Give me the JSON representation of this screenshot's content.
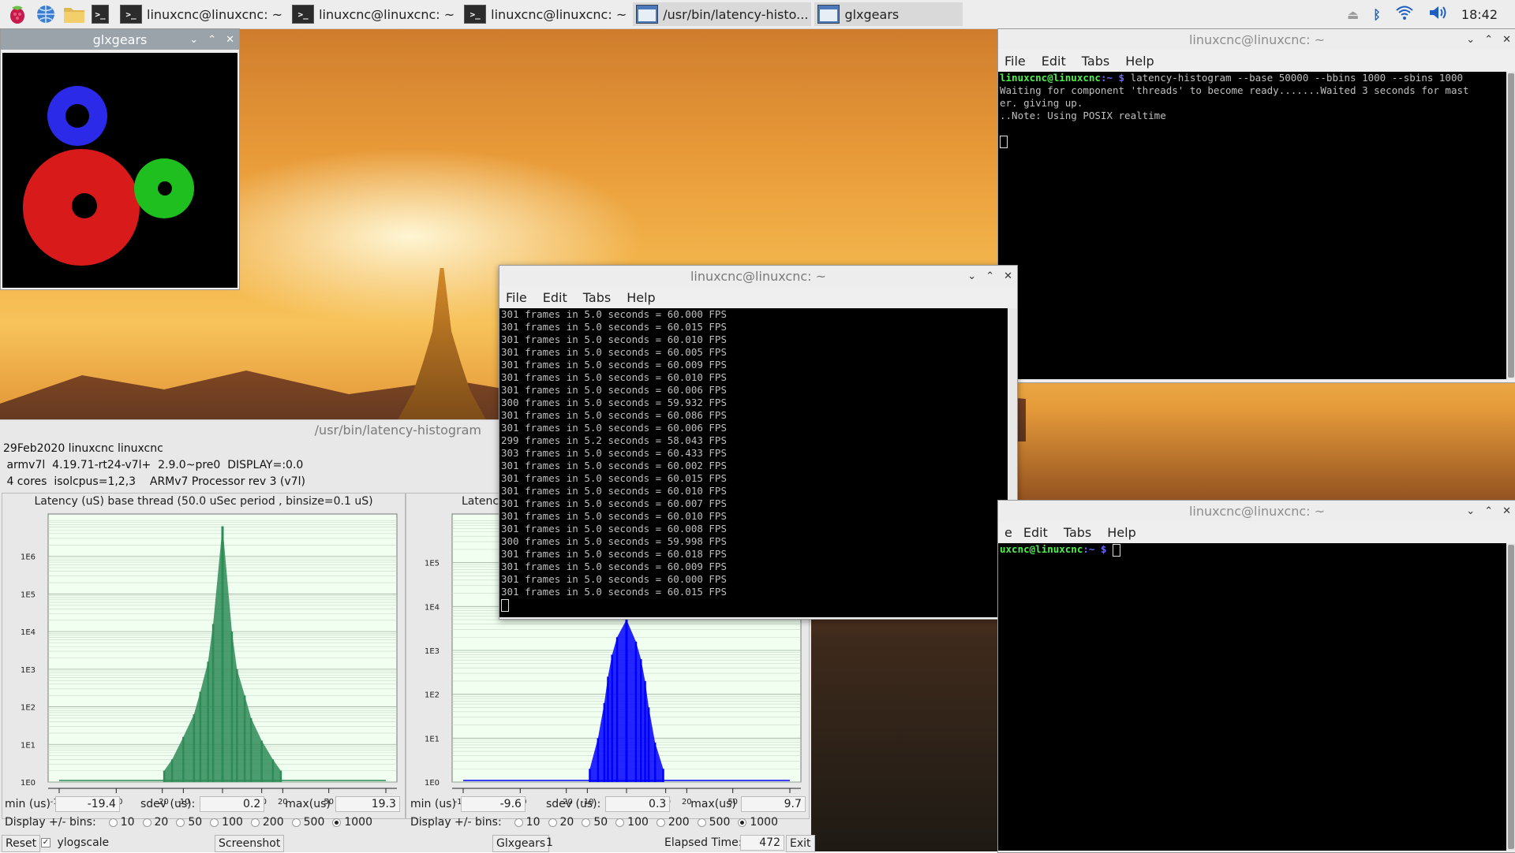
{
  "taskbar": {
    "tasks": [
      {
        "label": "linuxcnc@linuxcnc: ~"
      },
      {
        "label": "linuxcnc@linuxcnc: ~"
      },
      {
        "label": "linuxcnc@linuxcnc: ~"
      },
      {
        "label": "/usr/bin/latency-histo..."
      },
      {
        "label": "glxgears"
      }
    ],
    "clock": "18:42"
  },
  "glxgears": {
    "title": "glxgears"
  },
  "terminal_top_right": {
    "title": "linuxcnc@linuxcnc: ~",
    "menu": [
      "File",
      "Edit",
      "Tabs",
      "Help"
    ],
    "prompt_user": "linuxcnc@linuxcnc",
    "prompt_path": ":~ $",
    "command": " latency-histogram --base 50000 --bbins 1000 --sbins 1000",
    "output": [
      "Waiting for component 'threads' to become ready.......Waited 3 seconds for mast",
      "er.  giving up.",
      "..Note: Using POSIX realtime"
    ]
  },
  "terminal_center": {
    "title": "linuxcnc@linuxcnc: ~",
    "menu": [
      "File",
      "Edit",
      "Tabs",
      "Help"
    ],
    "lines": [
      "301 frames in 5.0 seconds = 60.000 FPS",
      "301 frames in 5.0 seconds = 60.015 FPS",
      "301 frames in 5.0 seconds = 60.010 FPS",
      "301 frames in 5.0 seconds = 60.005 FPS",
      "301 frames in 5.0 seconds = 60.009 FPS",
      "301 frames in 5.0 seconds = 60.010 FPS",
      "301 frames in 5.0 seconds = 60.006 FPS",
      "300 frames in 5.0 seconds = 59.932 FPS",
      "301 frames in 5.0 seconds = 60.086 FPS",
      "301 frames in 5.0 seconds = 60.006 FPS",
      "299 frames in 5.2 seconds = 58.043 FPS",
      "303 frames in 5.0 seconds = 60.433 FPS",
      "301 frames in 5.0 seconds = 60.002 FPS",
      "301 frames in 5.0 seconds = 60.015 FPS",
      "301 frames in 5.0 seconds = 60.010 FPS",
      "301 frames in 5.0 seconds = 60.007 FPS",
      "301 frames in 5.0 seconds = 60.010 FPS",
      "301 frames in 5.0 seconds = 60.008 FPS",
      "300 frames in 5.0 seconds = 59.998 FPS",
      "301 frames in 5.0 seconds = 60.018 FPS",
      "301 frames in 5.0 seconds = 60.009 FPS",
      "301 frames in 5.0 seconds = 60.000 FPS",
      "301 frames in 5.0 seconds = 60.015 FPS"
    ]
  },
  "terminal_bottom_right": {
    "title": "linuxcnc@linuxcnc: ~",
    "menu": [
      "e",
      "Edit",
      "Tabs",
      "Help"
    ],
    "prompt_user": "uxcnc@linuxcnc",
    "prompt_path": ":~ $"
  },
  "histogram_window": {
    "title": "/usr/bin/latency-histogram",
    "info_lines": [
      "29Feb2020 linuxcnc linuxcnc",
      " armv7l  4.19.71-rt24-v7l+  2.9.0~pre0  DISPLAY=:0.0",
      " 4 cores  isolcpus=1,2,3    ARMv7 Processor rev 3 (v7l)"
    ],
    "base": {
      "title": "Latency (uS) base thread (50.0 uSec period , binsize=0.1 uS)",
      "min_label": "min (us)",
      "min": "-19.4",
      "sdev_label": "sdev (us):",
      "sdev": "0.2",
      "max_label": "max(us)",
      "max": "19.3"
    },
    "servo": {
      "title": "Latency",
      "min_label": "min (us)",
      "min": "-9.6",
      "sdev_label": "sdev (us):",
      "sdev": "0.3",
      "max_label": "max(us)",
      "max": "9.7"
    },
    "bins_label": "Display +/- bins:",
    "bins": [
      "10",
      "20",
      "50",
      "100",
      "200",
      "500",
      "1000"
    ],
    "bins_selected": "1000",
    "reset": "Reset",
    "ylogscale": "ylogscale",
    "screenshot": "Screenshot",
    "glxgears_label": "Glxgears",
    "glxgears_value": "1",
    "elapsed_label": "Elapsed Time:",
    "elapsed_value": "472",
    "exit": "Exit"
  },
  "chart_data": [
    {
      "type": "bar",
      "title": "Latency (uS) base thread (50.0 uSec period , binsize=0.1 uS)",
      "color": "#2e8b57",
      "x_ticks": [
        "-100",
        "-50",
        "-20",
        "-10",
        "0",
        "10",
        "20",
        "50",
        "100"
      ],
      "y_ticks": [
        "1E0",
        "1E1",
        "1E2",
        "1E3",
        "1E4",
        "1E5",
        "1E6"
      ],
      "y_scale": "log",
      "x": [
        -19,
        -15,
        -10,
        -6,
        -4,
        -2,
        -1,
        0,
        1,
        2,
        4,
        6,
        10,
        15,
        19
      ],
      "y_log10": [
        0.3,
        0.6,
        1.2,
        1.8,
        2.4,
        3.2,
        4.2,
        6.8,
        4.0,
        3.0,
        2.3,
        1.7,
        1.1,
        0.6,
        0.3
      ]
    },
    {
      "type": "bar",
      "title": "Latency",
      "color": "#0000ff",
      "x_ticks": [
        "-100",
        "-50",
        "-20",
        "-10",
        "0",
        "10",
        "20",
        "50",
        "100"
      ],
      "y_ticks": [
        "1E0",
        "1E1",
        "1E2",
        "1E3",
        "1E4",
        "1E5"
      ],
      "y_scale": "log",
      "x": [
        -9,
        -6,
        -4,
        -3,
        -2,
        -1,
        0,
        1,
        2,
        3,
        4,
        6,
        9
      ],
      "y_log10": [
        0.3,
        1.0,
        1.8,
        2.4,
        2.9,
        3.3,
        3.7,
        3.2,
        2.8,
        2.3,
        1.7,
        0.9,
        0.3
      ]
    }
  ]
}
